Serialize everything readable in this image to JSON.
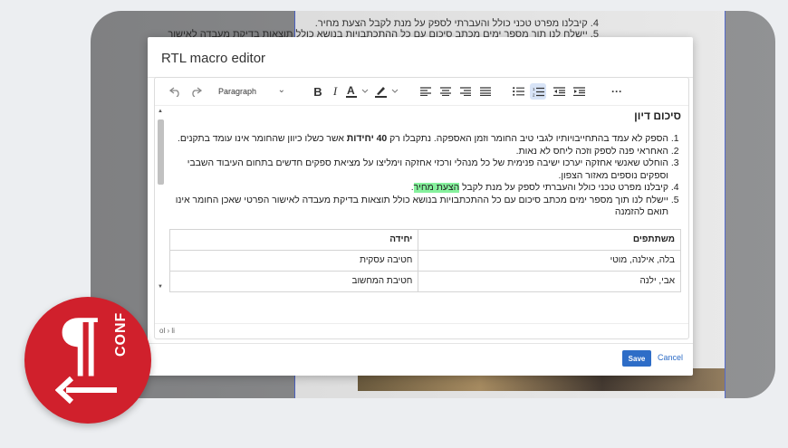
{
  "background": {
    "line1": "4. קיבלנו מפרט טכני כולל והעברתי לספק על מנת לקבל הצעת מחיר.",
    "line2": "5. יישלח לנו תוך מספר ימים מכתב סיכום עם כל ההתכתבויות בנושא כולל תוצאות בדיקת מעבדה לאישור"
  },
  "modal": {
    "title": "RTL macro editor",
    "save_label": "Save",
    "cancel_label": "Cancel"
  },
  "toolbar": {
    "paragraph_label": "Paragraph",
    "more_label": "···"
  },
  "document": {
    "heading": "סיכום דיון",
    "items": [
      {
        "pre": "הספק לא עמד בהתחייבויותיו לגבי טיב החומר וזמן האספקה. נתקבלו רק ",
        "bold": "40 יחידות",
        "post": " אשר כשלו כיוון שהחומר אינו עומד בתקנים."
      },
      {
        "text": "האחראי פנה לספק וזכה ליחס לא נאות."
      },
      {
        "text": "הוחלט שאנשי אחזקה יערכו ישיבה פנימית של כל מנהלי ורכזי אחזקה וימליצו על מציאת ספקים חדשים בתחום העיבוד השבבי וספקים נוספים מאזור הצפון."
      },
      {
        "pre": "קיבלנו מפרט טכני כולל והעברתי לספק על מנת לקבל ",
        "highlight": "הצעת מחיר",
        "post": "."
      },
      {
        "text": "יישלח לנו תוך מספר ימים מכתב סיכום עם כל ההתכתבויות בנושא כולל תוצאות בדיקת מעבדה לאישור הפרטי שאכן החומר אינו תואם להזמנה"
      }
    ],
    "table": {
      "headers": [
        "משתתפים",
        "יחידה"
      ],
      "rows": [
        [
          "בלה, אילנה, מוטי",
          "חטיבה עסקית"
        ],
        [
          "אבי, ילנה",
          "חטיבת המחשוב"
        ]
      ]
    }
  },
  "statusbar": {
    "path": "ol › li"
  },
  "logo": {
    "text": "CONF"
  },
  "colors": {
    "accent": "#2e6dc7",
    "highlight": "#86f19d",
    "logo": "#d0202c"
  }
}
